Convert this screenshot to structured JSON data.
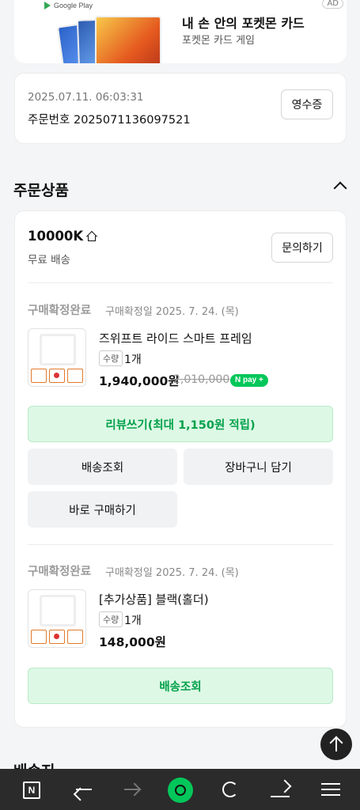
{
  "ad": {
    "store_label": "Google Play",
    "title": "내 손 안의 포켓몬 카드",
    "subtitle": "포켓몬 카드 게임",
    "badge": "AD"
  },
  "order": {
    "datetime": "2025.07.11. 06:03:31",
    "order_number_label": "주문번호 2025071136097521",
    "receipt_label": "영수증"
  },
  "section": {
    "title": "주문상품",
    "next_title": "배송지"
  },
  "store": {
    "name": "10000K",
    "shipping": "무료 배송",
    "inquiry_label": "문의하기"
  },
  "items": [
    {
      "status": "구매확정완료",
      "status_date": "구매확정일 2025. 7. 24. (목)",
      "name": "즈위프트 라이드 스마트 프레임",
      "qty_label": "수량",
      "qty": "1개",
      "price": "1,940,000원",
      "original_price": "2,010,000",
      "npay_label": "N pay +",
      "review_label": "리뷰쓰기(최대 1,150원 적립)",
      "tracking_label": "배송조회",
      "cart_label": "장바구니 담기",
      "buy_now_label": "바로 구매하기"
    },
    {
      "status": "구매확정완료",
      "status_date": "구매확정일 2025. 7. 24. (목)",
      "name": "[추가상품] 블랙(홀더)",
      "qty_label": "수량",
      "qty": "1개",
      "price": "148,000원",
      "tracking_label": "배송조회"
    }
  ],
  "bottom_nav": {
    "home_letter": "N"
  },
  "colors": {
    "accent_green": "#03c75a",
    "review_bg": "#ddf8e5",
    "nav_bg": "#2b2b2b"
  }
}
